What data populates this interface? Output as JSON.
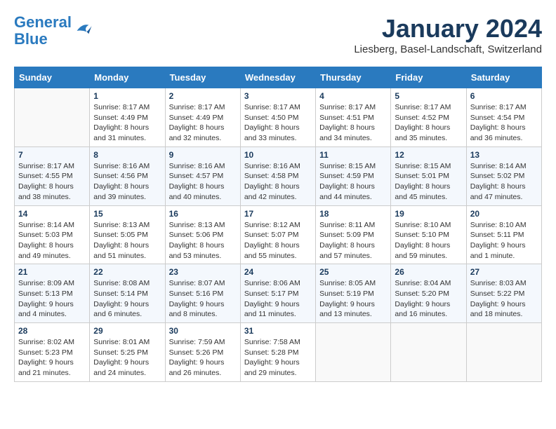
{
  "header": {
    "logo_line1": "General",
    "logo_line2": "Blue",
    "month_title": "January 2024",
    "subtitle": "Liesberg, Basel-Landschaft, Switzerland"
  },
  "weekdays": [
    "Sunday",
    "Monday",
    "Tuesday",
    "Wednesday",
    "Thursday",
    "Friday",
    "Saturday"
  ],
  "weeks": [
    [
      {
        "day": "",
        "info": ""
      },
      {
        "day": "1",
        "info": "Sunrise: 8:17 AM\nSunset: 4:49 PM\nDaylight: 8 hours\nand 31 minutes."
      },
      {
        "day": "2",
        "info": "Sunrise: 8:17 AM\nSunset: 4:49 PM\nDaylight: 8 hours\nand 32 minutes."
      },
      {
        "day": "3",
        "info": "Sunrise: 8:17 AM\nSunset: 4:50 PM\nDaylight: 8 hours\nand 33 minutes."
      },
      {
        "day": "4",
        "info": "Sunrise: 8:17 AM\nSunset: 4:51 PM\nDaylight: 8 hours\nand 34 minutes."
      },
      {
        "day": "5",
        "info": "Sunrise: 8:17 AM\nSunset: 4:52 PM\nDaylight: 8 hours\nand 35 minutes."
      },
      {
        "day": "6",
        "info": "Sunrise: 8:17 AM\nSunset: 4:54 PM\nDaylight: 8 hours\nand 36 minutes."
      }
    ],
    [
      {
        "day": "7",
        "info": "Sunrise: 8:17 AM\nSunset: 4:55 PM\nDaylight: 8 hours\nand 38 minutes."
      },
      {
        "day": "8",
        "info": "Sunrise: 8:16 AM\nSunset: 4:56 PM\nDaylight: 8 hours\nand 39 minutes."
      },
      {
        "day": "9",
        "info": "Sunrise: 8:16 AM\nSunset: 4:57 PM\nDaylight: 8 hours\nand 40 minutes."
      },
      {
        "day": "10",
        "info": "Sunrise: 8:16 AM\nSunset: 4:58 PM\nDaylight: 8 hours\nand 42 minutes."
      },
      {
        "day": "11",
        "info": "Sunrise: 8:15 AM\nSunset: 4:59 PM\nDaylight: 8 hours\nand 44 minutes."
      },
      {
        "day": "12",
        "info": "Sunrise: 8:15 AM\nSunset: 5:01 PM\nDaylight: 8 hours\nand 45 minutes."
      },
      {
        "day": "13",
        "info": "Sunrise: 8:14 AM\nSunset: 5:02 PM\nDaylight: 8 hours\nand 47 minutes."
      }
    ],
    [
      {
        "day": "14",
        "info": "Sunrise: 8:14 AM\nSunset: 5:03 PM\nDaylight: 8 hours\nand 49 minutes."
      },
      {
        "day": "15",
        "info": "Sunrise: 8:13 AM\nSunset: 5:05 PM\nDaylight: 8 hours\nand 51 minutes."
      },
      {
        "day": "16",
        "info": "Sunrise: 8:13 AM\nSunset: 5:06 PM\nDaylight: 8 hours\nand 53 minutes."
      },
      {
        "day": "17",
        "info": "Sunrise: 8:12 AM\nSunset: 5:07 PM\nDaylight: 8 hours\nand 55 minutes."
      },
      {
        "day": "18",
        "info": "Sunrise: 8:11 AM\nSunset: 5:09 PM\nDaylight: 8 hours\nand 57 minutes."
      },
      {
        "day": "19",
        "info": "Sunrise: 8:10 AM\nSunset: 5:10 PM\nDaylight: 8 hours\nand 59 minutes."
      },
      {
        "day": "20",
        "info": "Sunrise: 8:10 AM\nSunset: 5:11 PM\nDaylight: 9 hours\nand 1 minute."
      }
    ],
    [
      {
        "day": "21",
        "info": "Sunrise: 8:09 AM\nSunset: 5:13 PM\nDaylight: 9 hours\nand 4 minutes."
      },
      {
        "day": "22",
        "info": "Sunrise: 8:08 AM\nSunset: 5:14 PM\nDaylight: 9 hours\nand 6 minutes."
      },
      {
        "day": "23",
        "info": "Sunrise: 8:07 AM\nSunset: 5:16 PM\nDaylight: 9 hours\nand 8 minutes."
      },
      {
        "day": "24",
        "info": "Sunrise: 8:06 AM\nSunset: 5:17 PM\nDaylight: 9 hours\nand 11 minutes."
      },
      {
        "day": "25",
        "info": "Sunrise: 8:05 AM\nSunset: 5:19 PM\nDaylight: 9 hours\nand 13 minutes."
      },
      {
        "day": "26",
        "info": "Sunrise: 8:04 AM\nSunset: 5:20 PM\nDaylight: 9 hours\nand 16 minutes."
      },
      {
        "day": "27",
        "info": "Sunrise: 8:03 AM\nSunset: 5:22 PM\nDaylight: 9 hours\nand 18 minutes."
      }
    ],
    [
      {
        "day": "28",
        "info": "Sunrise: 8:02 AM\nSunset: 5:23 PM\nDaylight: 9 hours\nand 21 minutes."
      },
      {
        "day": "29",
        "info": "Sunrise: 8:01 AM\nSunset: 5:25 PM\nDaylight: 9 hours\nand 24 minutes."
      },
      {
        "day": "30",
        "info": "Sunrise: 7:59 AM\nSunset: 5:26 PM\nDaylight: 9 hours\nand 26 minutes."
      },
      {
        "day": "31",
        "info": "Sunrise: 7:58 AM\nSunset: 5:28 PM\nDaylight: 9 hours\nand 29 minutes."
      },
      {
        "day": "",
        "info": ""
      },
      {
        "day": "",
        "info": ""
      },
      {
        "day": "",
        "info": ""
      }
    ]
  ]
}
